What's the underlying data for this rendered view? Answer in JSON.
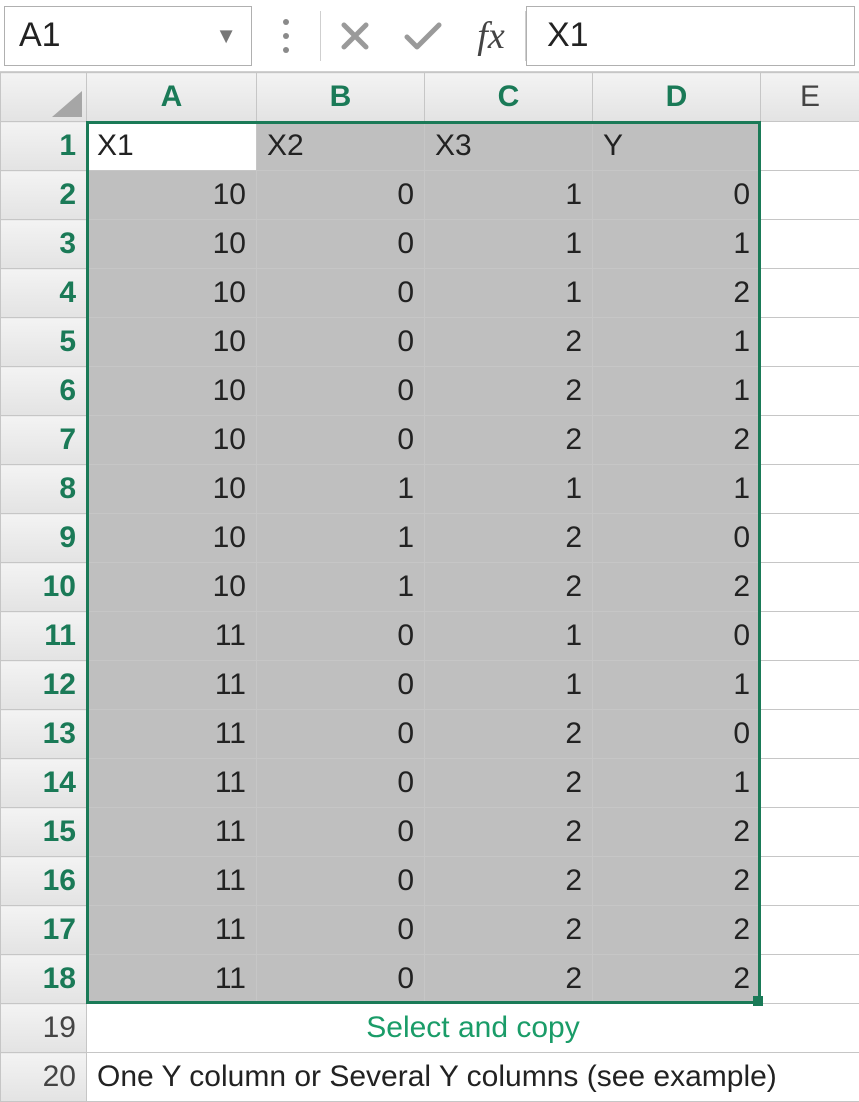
{
  "formula_bar": {
    "name_box": "A1",
    "fx_label": "fx",
    "value": "X1"
  },
  "columns": [
    "A",
    "B",
    "C",
    "D",
    "E"
  ],
  "selected_cols": 4,
  "rows": [
    1,
    2,
    3,
    4,
    5,
    6,
    7,
    8,
    9,
    10,
    11,
    12,
    13,
    14,
    15,
    16,
    17,
    18,
    19,
    20
  ],
  "selected_rows": 18,
  "headers": [
    "X1",
    "X2",
    "X3",
    "Y"
  ],
  "data": [
    [
      10,
      0,
      1,
      0
    ],
    [
      10,
      0,
      1,
      1
    ],
    [
      10,
      0,
      1,
      2
    ],
    [
      10,
      0,
      2,
      1
    ],
    [
      10,
      0,
      2,
      1
    ],
    [
      10,
      0,
      2,
      2
    ],
    [
      10,
      1,
      1,
      1
    ],
    [
      10,
      1,
      2,
      0
    ],
    [
      10,
      1,
      2,
      2
    ],
    [
      11,
      0,
      1,
      0
    ],
    [
      11,
      0,
      1,
      1
    ],
    [
      11,
      0,
      2,
      0
    ],
    [
      11,
      0,
      2,
      1
    ],
    [
      11,
      0,
      2,
      2
    ],
    [
      11,
      0,
      2,
      2
    ],
    [
      11,
      0,
      2,
      2
    ],
    [
      11,
      0,
      2,
      2
    ]
  ],
  "hint_text": "Select and copy",
  "note_text": "One Y column or Several Y columns (see example)",
  "chart_data": {
    "type": "table",
    "columns": [
      "X1",
      "X2",
      "X3",
      "Y"
    ],
    "rows": [
      [
        10,
        0,
        1,
        0
      ],
      [
        10,
        0,
        1,
        1
      ],
      [
        10,
        0,
        1,
        2
      ],
      [
        10,
        0,
        2,
        1
      ],
      [
        10,
        0,
        2,
        1
      ],
      [
        10,
        0,
        2,
        2
      ],
      [
        10,
        1,
        1,
        1
      ],
      [
        10,
        1,
        2,
        0
      ],
      [
        10,
        1,
        2,
        2
      ],
      [
        11,
        0,
        1,
        0
      ],
      [
        11,
        0,
        1,
        1
      ],
      [
        11,
        0,
        2,
        0
      ],
      [
        11,
        0,
        2,
        1
      ],
      [
        11,
        0,
        2,
        2
      ],
      [
        11,
        0,
        2,
        2
      ],
      [
        11,
        0,
        2,
        2
      ],
      [
        11,
        0,
        2,
        2
      ]
    ]
  }
}
